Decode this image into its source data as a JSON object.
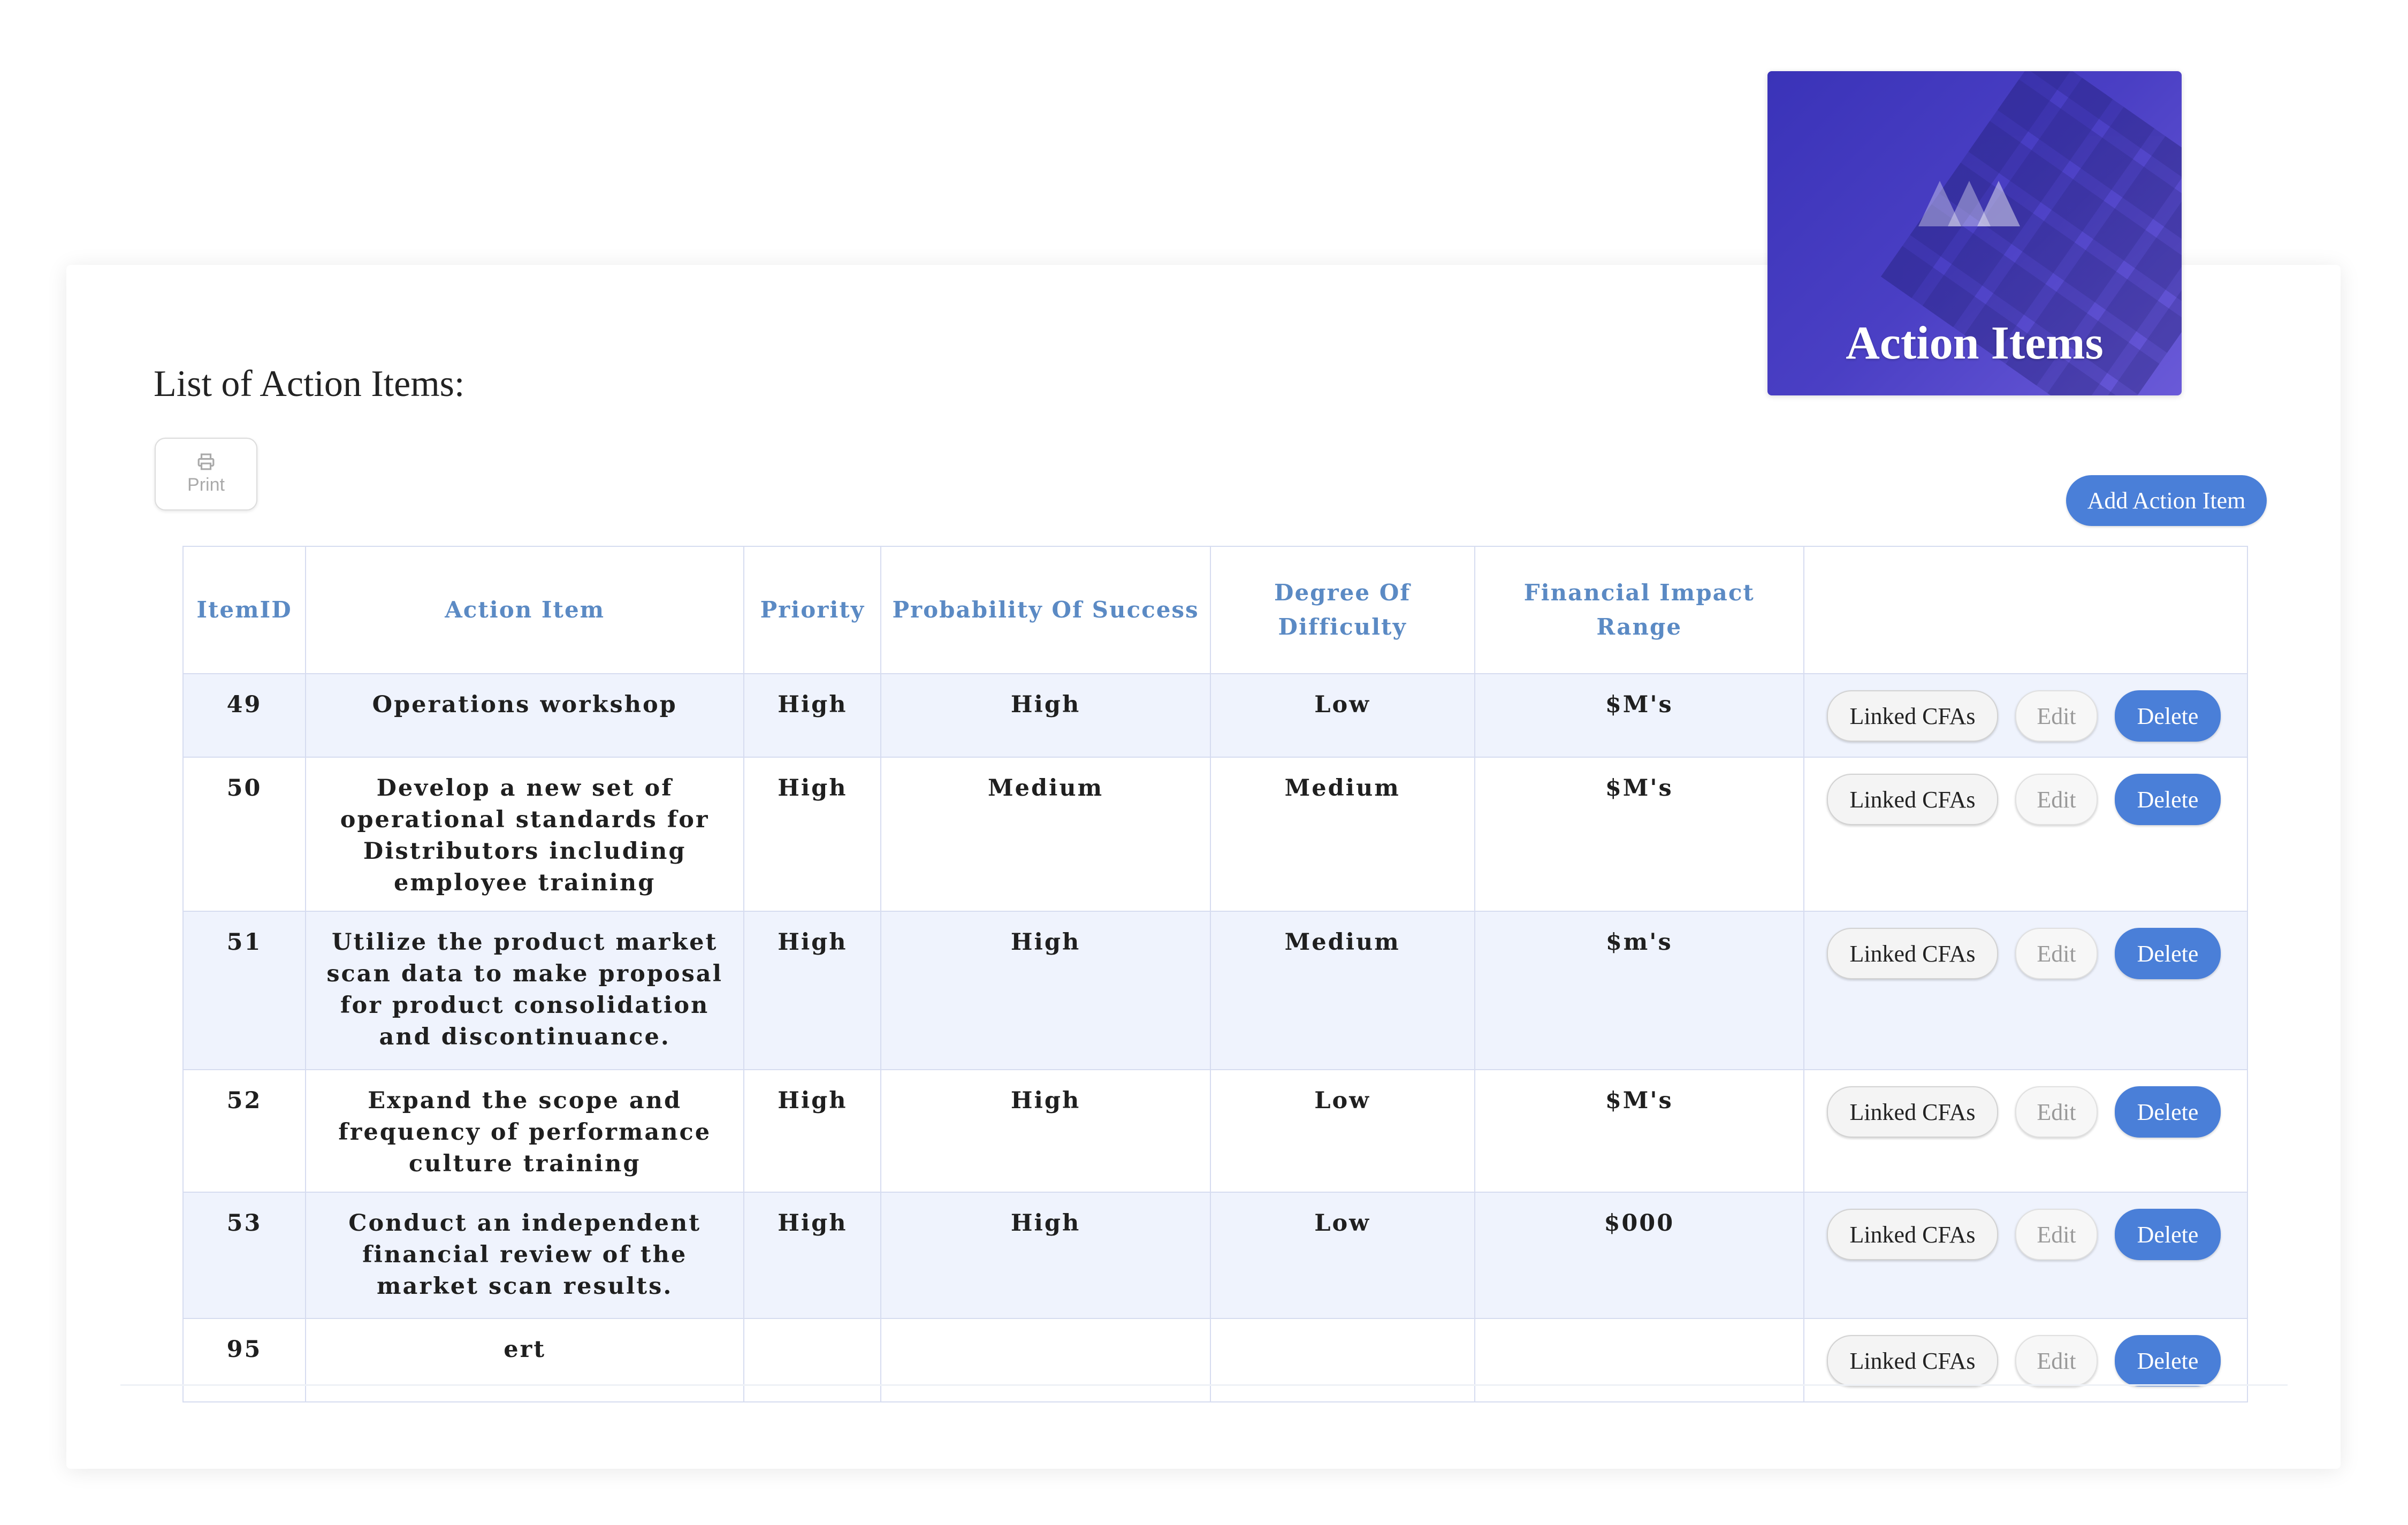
{
  "hero": {
    "title": "Action Items",
    "icon": "mountains-icon"
  },
  "page": {
    "list_title": "List of Action Items:"
  },
  "toolbar": {
    "print_label": "Print",
    "add_label": "Add Action Item"
  },
  "table": {
    "headers": {
      "item_id": "ItemID",
      "action_item": "Action Item",
      "priority": "Priority",
      "probability": "Probability Of Success",
      "difficulty": "Degree Of Difficulty",
      "financial": "Financial Impact Range",
      "actions": ""
    },
    "rows": [
      {
        "id": "49",
        "action": "Operations workshop",
        "priority": "High",
        "probability": "High",
        "difficulty": "Low",
        "financial": "$M's"
      },
      {
        "id": "50",
        "action": "Develop a new set of operational standards for Distributors including employee training",
        "priority": "High",
        "probability": "Medium",
        "difficulty": "Medium",
        "financial": "$M's"
      },
      {
        "id": "51",
        "action": "Utilize the product market scan data to make proposal for product consolidation and discontinuance.",
        "priority": "High",
        "probability": "High",
        "difficulty": "Medium",
        "financial": "$m's"
      },
      {
        "id": "52",
        "action": "Expand the scope and frequency of performance culture training",
        "priority": "High",
        "probability": "High",
        "difficulty": "Low",
        "financial": "$M's"
      },
      {
        "id": "53",
        "action": "Conduct an independent financial review of the market scan results.",
        "priority": "High",
        "probability": "High",
        "difficulty": "Low",
        "financial": "$000"
      },
      {
        "id": "95",
        "action": "ert",
        "priority": "",
        "probability": "",
        "difficulty": "",
        "financial": ""
      }
    ],
    "row_actions": {
      "linked": "Linked CFAs",
      "edit": "Edit",
      "delete": "Delete"
    }
  },
  "colors": {
    "accent": "#4a7fd8",
    "header_text": "#5b8ac4",
    "row_stripe": "#eff3fd",
    "hero_bg": "#4a3fc4"
  }
}
